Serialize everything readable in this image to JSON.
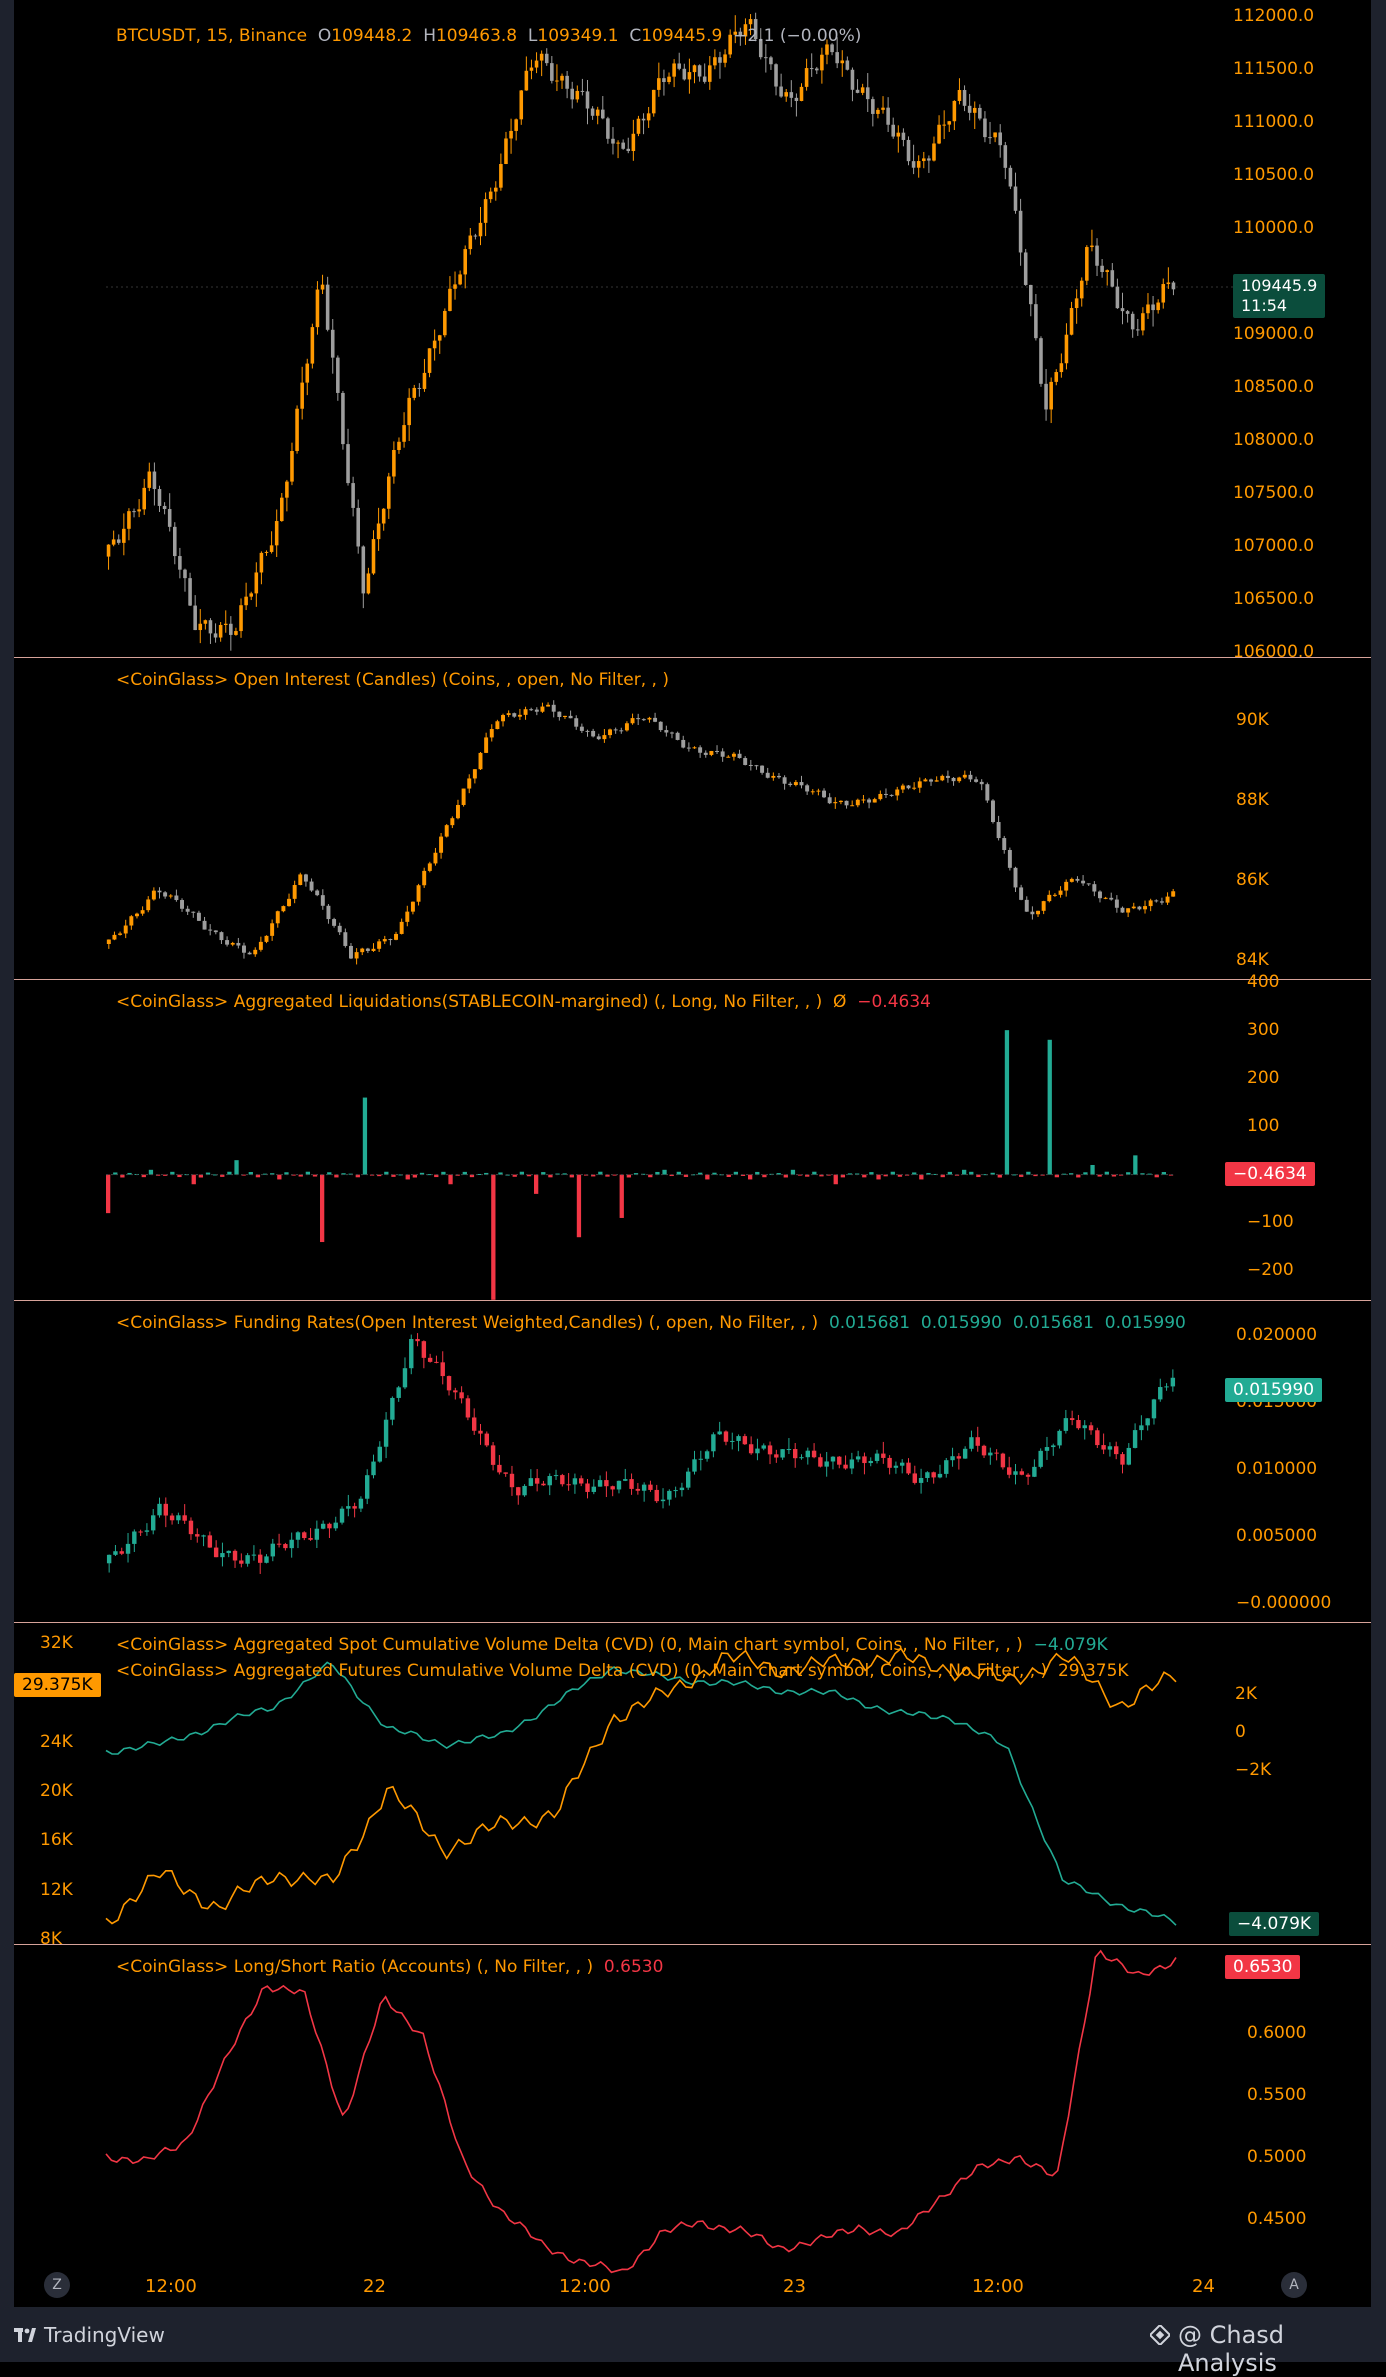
{
  "price_pane": {
    "legend": {
      "symbol": "BTCUSDT, 15, Binance",
      "o_label": "O",
      "o": "109448.2",
      "h_label": "H",
      "h": "109463.8",
      "l_label": "L",
      "l": "109349.1",
      "c_label": "C",
      "c": "109445.9",
      "change": "−2.1 (−0.00%)"
    },
    "axis_ticks": [
      "112000.0",
      "111500.0",
      "111000.0",
      "110500.0",
      "110000.0",
      "109000.0",
      "108500.0",
      "108000.0",
      "107500.0",
      "107000.0",
      "106500.0",
      "106000.0"
    ],
    "last_price": "109445.9",
    "countdown": "11:54"
  },
  "oi_pane": {
    "legend": "<CoinGlass> Open Interest (Candles) (Coins, , open, No Filter, , )",
    "axis_ticks": [
      "90K",
      "88K",
      "86K",
      "84K"
    ]
  },
  "liq_pane": {
    "legend": "<CoinGlass> Aggregated Liquidations(STABLECOIN-margined) (, Long, No Filter, , )",
    "legend_symbol": "Ø",
    "legend_value": "−0.4634",
    "axis_ticks": [
      "400",
      "300",
      "200",
      "100",
      "−100",
      "−200"
    ],
    "badge": "−0.4634"
  },
  "funding_pane": {
    "legend": "<CoinGlass> Funding Rates(Open Interest Weighted,Candles) (, open, No Filter, , )",
    "values": [
      "0.015681",
      "0.015990",
      "0.015681",
      "0.015990"
    ],
    "axis_ticks": [
      "0.020000",
      "0.015000",
      "0.010000",
      "0.005000",
      "−0.000000"
    ],
    "badge": "0.015990"
  },
  "cvd_pane": {
    "legend_spot": "<CoinGlass> Aggregated Spot Cumulative Volume Delta (CVD) (0, Main chart symbol, Coins, , No Filter, , )",
    "legend_spot_value": "−4.079K",
    "legend_futures": "<CoinGlass> Aggregated Futures Cumulative Volume Delta (CVD) (0, Main chart symbol, Coins, , No Filter, , )",
    "legend_futures_value": "29.375K",
    "left_ticks": [
      "32K",
      "28K",
      "24K",
      "20K",
      "16K",
      "12K",
      "8K"
    ],
    "right_ticks": [
      "2K",
      "0",
      "−2K"
    ],
    "left_badge": "29.375K",
    "right_badge": "−4.079K"
  },
  "ls_pane": {
    "legend": "<CoinGlass> Long/Short Ratio (Accounts) (, No Filter, , )",
    "legend_value": "0.6530",
    "axis_ticks": [
      "0.6000",
      "0.5500",
      "0.5000",
      "0.4500"
    ],
    "badge": "0.6530"
  },
  "time_axis": [
    "12:00",
    "22",
    "12:00",
    "23",
    "12:00",
    "24"
  ],
  "buttons": {
    "left": "Z",
    "right": "A"
  },
  "footer": {
    "brand": "TradingView",
    "watermark": "@ Chasd Analysis"
  },
  "colors": {
    "up": "#ff9900",
    "down": "#9e9e9e",
    "teal": "#22ab94",
    "red": "#f23645",
    "separator": "#d7a39a"
  },
  "chart_data": [
    {
      "type": "candlestick",
      "title": "BTCUSDT, 15, Binance",
      "ylim": [
        106000,
        112000
      ],
      "x": [
        "12:00",
        "22",
        "12:00",
        "23",
        "12:00",
        "24"
      ],
      "series": [
        {
          "values": [
            106900,
            107700,
            106300,
            106200,
            107300,
            109500,
            106600,
            108300,
            109300,
            110400,
            111600,
            111300,
            110700,
            111400,
            111500,
            111900,
            111200,
            111700,
            111100,
            110600,
            111200,
            110800,
            108300,
            109800,
            109100,
            109446
          ]
        }
      ]
    },
    {
      "type": "candlestick",
      "title": "<CoinGlass> Open Interest (Candles) (Coins, , open, No Filter, , )",
      "ylim": [
        84000,
        91000
      ],
      "series": [
        {
          "values": [
            84700,
            86000,
            85100,
            84400,
            86400,
            84400,
            85000,
            87500,
            89900,
            90300,
            89500,
            90000,
            89300,
            89000,
            88500,
            88000,
            88100,
            88600,
            88500,
            85300,
            86300,
            85400,
            85900
          ]
        }
      ]
    },
    {
      "type": "bar",
      "title": "<CoinGlass> Aggregated Liquidations(STABLECOIN-margined) (, Long, No Filter, , )",
      "ylim": [
        -250,
        400
      ],
      "series": [
        {
          "values": [
            -80,
            10,
            -20,
            30,
            -10,
            -140,
            160,
            -10,
            -20,
            -260,
            -40,
            -130,
            -90,
            10,
            -10,
            10,
            -20,
            -10,
            -10,
            10,
            300,
            280,
            20,
            40,
            -0.4634
          ]
        }
      ]
    },
    {
      "type": "candlestick",
      "title": "<CoinGlass> Funding Rates(Open Interest Weighted,Candles) (, open, No Filter, , )",
      "ylim": [
        0,
        0.02
      ],
      "series": [
        {
          "values": [
            0.0025,
            0.0066,
            0.0035,
            0.0028,
            0.0048,
            0.007,
            0.019,
            0.0135,
            0.0078,
            0.0085,
            0.0081,
            0.0073,
            0.0115,
            0.0108,
            0.0097,
            0.0102,
            0.0085,
            0.011,
            0.0088,
            0.0127,
            0.0102,
            0.01599
          ]
        }
      ]
    },
    {
      "type": "line",
      "title": "<CoinGlass> Aggregated Cumulative Volume Delta (CVD)",
      "series": [
        {
          "name": "<CoinGlass> Aggregated Spot Cumulative Volume Delta (CVD) (0, Main chart symbol, Coins, , No Filter, , )",
          "values": [
            0.4,
            0.6,
            1.1,
            1.6,
            2.7,
            1.0,
            0.6,
            0.8,
            1.7,
            2.6,
            2.3,
            2.2,
            2.0,
            1.9,
            1.4,
            1.3,
            0.5,
            -3.0,
            -3.6,
            -4.079
          ]
        },
        {
          "name": "<CoinGlass> Aggregated Futures Cumulative Volume Delta (CVD) (0, Main chart symbol, Coins, , No Filter, , )",
          "values": [
            9000,
            13000,
            10000,
            13000,
            12000,
            20000,
            15000,
            17000,
            18000,
            26000,
            28000,
            31000,
            30000,
            30500,
            31000,
            30000,
            29000,
            31000,
            27000,
            29375
          ]
        }
      ]
    },
    {
      "type": "line",
      "title": "<CoinGlass> Long/Short Ratio (Accounts) (, No Filter, , )",
      "ylim": [
        0.44,
        0.66
      ],
      "series": [
        {
          "values": [
            0.515,
            0.51,
            0.525,
            0.58,
            0.635,
            0.628,
            0.54,
            0.625,
            0.6,
            0.51,
            0.475,
            0.452,
            0.44,
            0.432,
            0.46,
            0.468,
            0.462,
            0.45,
            0.455,
            0.465,
            0.458,
            0.485,
            0.505,
            0.515,
            0.498,
            0.66,
            0.64,
            0.653
          ]
        }
      ]
    }
  ]
}
